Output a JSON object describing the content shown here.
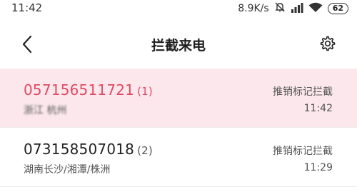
{
  "status_bar": {
    "time": "11:42",
    "net_speed": "8.9K/s",
    "battery": "62",
    "icons": [
      "mute-icon",
      "signal-icon",
      "wifi-icon",
      "battery-icon"
    ]
  },
  "header": {
    "title": "拦截来电",
    "back_icon": "back-arrow-icon",
    "settings_icon": "gear-icon"
  },
  "calls": [
    {
      "number": "057156511721",
      "count": "(1)",
      "location": "浙江 杭州",
      "tag": "推销标记拦截",
      "time": "11:42",
      "highlighted": true
    },
    {
      "number": "073158507018",
      "count": "(2)",
      "location": "湖南长沙/湘潭/株洲",
      "tag": "推销标记拦截",
      "time": "11:29",
      "highlighted": false
    }
  ],
  "colors": {
    "accent": "#e04b63",
    "highlight_bg": "#fbe7ec",
    "text": "#222222",
    "secondary_text": "#555555"
  }
}
